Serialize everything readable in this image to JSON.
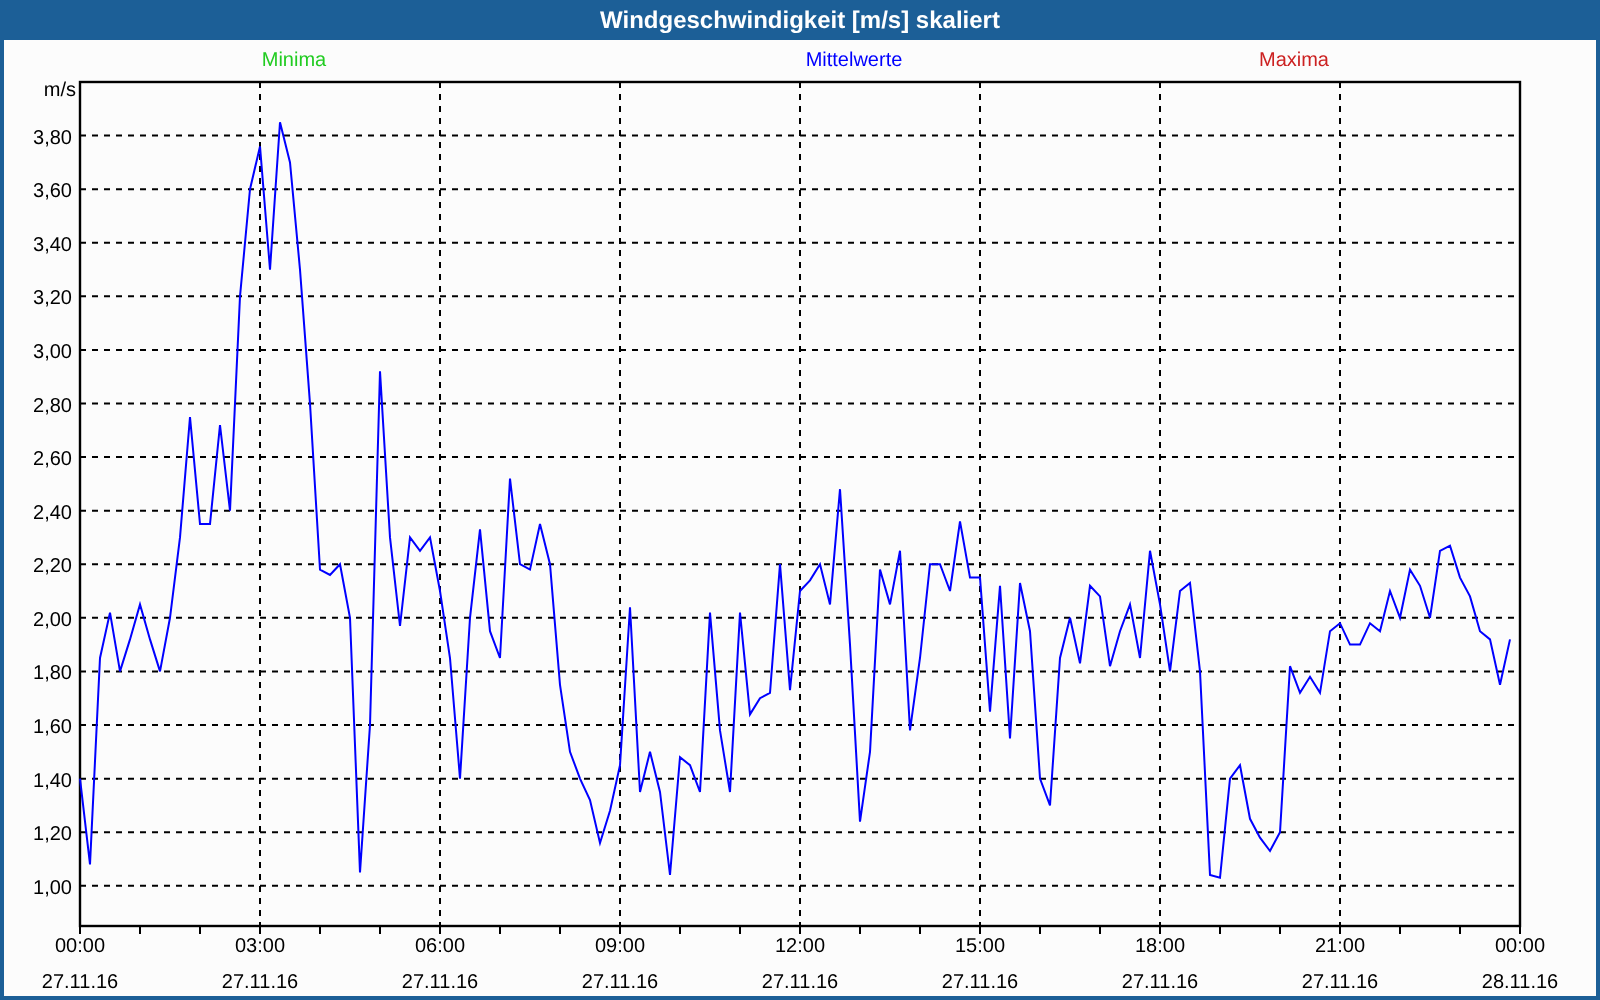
{
  "window": {
    "title": "Windgeschwindigkeit [m/s] skaliert"
  },
  "chart": {
    "legend": [
      {
        "label": "Minima",
        "color": "#22cc22"
      },
      {
        "label": "Maxima",
        "color": "#cc2222"
      }
    ],
    "chart_data": {
      "type": "line",
      "grid": true,
      "ylabel": "m/s",
      "ylim": [
        0.85,
        4.0
      ],
      "yticks": [
        {
          "value": 1.0,
          "label": "1,00"
        },
        {
          "value": 1.2,
          "label": "1,20"
        },
        {
          "value": 1.4,
          "label": "1,40"
        },
        {
          "value": 1.6,
          "label": "1,60"
        },
        {
          "value": 1.8,
          "label": "1,80"
        },
        {
          "value": 2.0,
          "label": "2,00"
        },
        {
          "value": 2.2,
          "label": "2,20"
        },
        {
          "value": 2.4,
          "label": "2,40"
        },
        {
          "value": 2.6,
          "label": "2,60"
        },
        {
          "value": 2.8,
          "label": "2,80"
        },
        {
          "value": 3.0,
          "label": "3,00"
        },
        {
          "value": 3.2,
          "label": "3,20"
        },
        {
          "value": 3.4,
          "label": "3,40"
        },
        {
          "value": 3.6,
          "label": "3,60"
        },
        {
          "value": 3.8,
          "label": "3,80"
        }
      ],
      "categories": [
        "00:00\n27.11.16",
        null,
        null,
        null,
        null,
        null,
        null,
        null,
        null,
        null,
        null,
        null,
        null,
        null,
        null,
        null,
        null,
        null,
        "03:00\n27.11.16",
        null,
        null,
        null,
        null,
        null,
        null,
        null,
        null,
        null,
        null,
        null,
        null,
        null,
        null,
        null,
        null,
        null,
        "06:00\n27.11.16",
        null,
        null,
        null,
        null,
        null,
        null,
        null,
        null,
        null,
        null,
        null,
        null,
        null,
        null,
        null,
        null,
        null,
        "09:00\n27.11.16",
        null,
        null,
        null,
        null,
        null,
        null,
        null,
        null,
        null,
        null,
        null,
        null,
        null,
        null,
        null,
        null,
        null,
        "12:00\n27.11.16",
        null,
        null,
        null,
        null,
        null,
        null,
        null,
        null,
        null,
        null,
        null,
        null,
        null,
        null,
        null,
        null,
        null,
        "15:00\n27.11.16",
        null,
        null,
        null,
        null,
        null,
        null,
        null,
        null,
        null,
        null,
        null,
        null,
        null,
        null,
        null,
        null,
        null,
        "18:00\n27.11.16",
        null,
        null,
        null,
        null,
        null,
        null,
        null,
        null,
        null,
        null,
        null,
        null,
        null,
        null,
        null,
        null,
        null,
        "21:00\n27.11.16",
        null,
        null,
        null,
        null,
        null,
        null,
        null,
        null,
        null,
        null,
        null,
        null,
        null,
        null,
        null,
        null,
        null,
        "00:00\n28.11.16"
      ],
      "series": [
        {
          "name": "Mittelwerte",
          "color": "#0000ff",
          "values": [
            1.4,
            1.08,
            1.85,
            2.02,
            1.8,
            1.92,
            2.05,
            1.92,
            1.8,
            2.0,
            2.3,
            2.75,
            2.35,
            2.35,
            2.72,
            2.4,
            3.2,
            3.6,
            3.76,
            3.3,
            3.85,
            3.7,
            3.3,
            2.8,
            2.18,
            2.16,
            2.2,
            2.0,
            1.05,
            1.6,
            2.92,
            2.3,
            1.97,
            2.3,
            2.25,
            2.3,
            2.1,
            1.85,
            1.4,
            2.0,
            2.33,
            1.95,
            1.85,
            2.52,
            2.2,
            2.18,
            2.35,
            2.2,
            1.75,
            1.5,
            1.4,
            1.32,
            1.16,
            1.28,
            1.45,
            2.04,
            1.35,
            1.5,
            1.35,
            1.04,
            1.48,
            1.45,
            1.35,
            2.02,
            1.58,
            1.35,
            2.02,
            1.64,
            1.7,
            1.72,
            2.2,
            1.73,
            2.1,
            2.14,
            2.2,
            2.05,
            2.48,
            1.9,
            1.24,
            1.5,
            2.18,
            2.05,
            2.25,
            1.58,
            1.85,
            2.2,
            2.2,
            2.1,
            2.36,
            2.15,
            2.15,
            1.65,
            2.12,
            1.55,
            2.13,
            1.95,
            1.4,
            1.3,
            1.85,
            2.0,
            1.83,
            2.12,
            2.08,
            1.82,
            1.95,
            2.05,
            1.85,
            2.25,
            2.05,
            1.8,
            2.1,
            2.13,
            1.8,
            1.04,
            1.03,
            1.4,
            1.45,
            1.25,
            1.18,
            1.13,
            1.2,
            1.82,
            1.72,
            1.78,
            1.72,
            1.95,
            1.98,
            1.9,
            1.9,
            1.98,
            1.95,
            2.1,
            2.0,
            2.18,
            2.12,
            2.0,
            2.25,
            2.27,
            2.15,
            2.08,
            1.95,
            1.92,
            1.75,
            1.92,
            null
          ]
        }
      ]
    }
  }
}
